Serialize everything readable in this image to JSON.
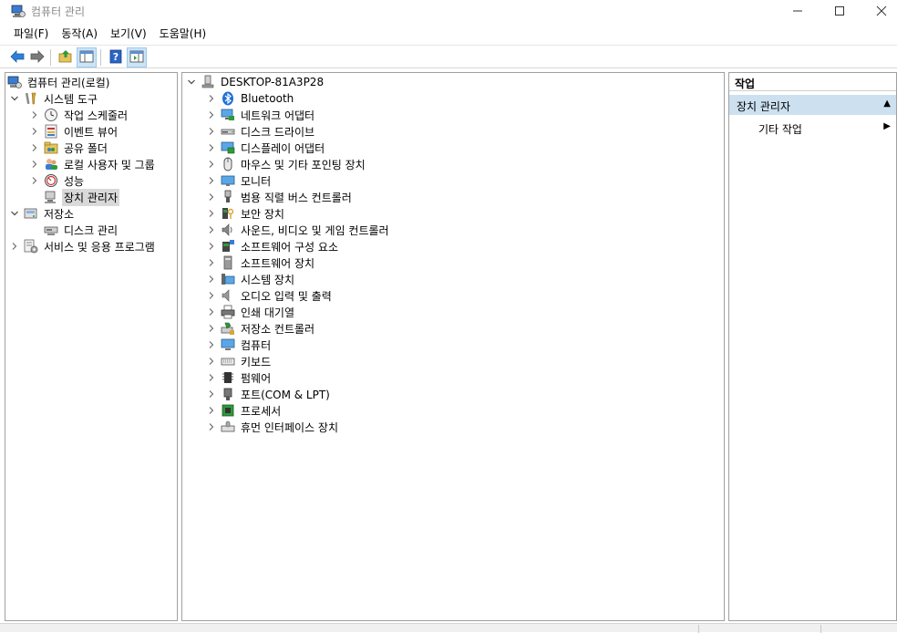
{
  "window": {
    "title": "컴퓨터 관리"
  },
  "menu": [
    "파일(F)",
    "동작(A)",
    "보기(V)",
    "도움말(H)"
  ],
  "toolbar": {
    "buttons": [
      "back-icon",
      "forward-icon",
      "up-folder-icon",
      "show-hide-console-tree-icon",
      "help-icon",
      "show-hide-action-pane-icon"
    ]
  },
  "left_tree": {
    "root": "컴퓨터 관리(로컬)",
    "system_tools": "시스템 도구",
    "task_scheduler": "작업 스케줄러",
    "event_viewer": "이벤트 뷰어",
    "shared_folders": "공유 폴더",
    "local_users": "로컬 사용자 및 그룹",
    "performance": "성능",
    "device_manager": "장치 관리자",
    "storage": "저장소",
    "disk_management": "디스크 관리",
    "services_apps": "서비스 및 응용 프로그램"
  },
  "device_tree": {
    "computer": "DESKTOP-81A3P28",
    "categories": [
      "Bluetooth",
      "네트워크 어댑터",
      "디스크 드라이브",
      "디스플레이 어댑터",
      "마우스 및 기타 포인팅 장치",
      "모니터",
      "범용 직렬 버스 컨트롤러",
      "보안 장치",
      "사운드, 비디오 및 게임 컨트롤러",
      "소프트웨어 구성 요소",
      "소프트웨어 장치",
      "시스템 장치",
      "오디오 입력 및 출력",
      "인쇄 대기열",
      "저장소 컨트롤러",
      "컴퓨터",
      "키보드",
      "펌웨어",
      "포트(COM & LPT)",
      "프로세서",
      "휴먼 인터페이스 장치"
    ]
  },
  "actions": {
    "header": "작업",
    "section": "장치 관리자",
    "item": "기타 작업"
  },
  "colors": {
    "selection": "#cce0f0",
    "accent_blue": "#1e88e5"
  }
}
